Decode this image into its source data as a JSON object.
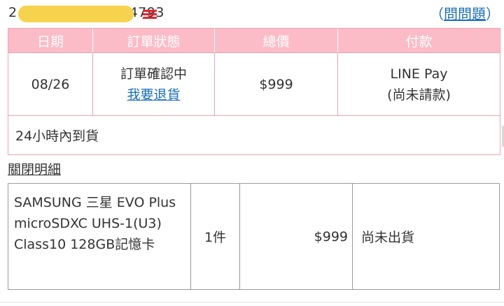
{
  "order": {
    "number_prefix": "2",
    "number_suffix": "4793",
    "brand_icon": "brand-stripes-icon",
    "ask_link": {
      "open_paren": "（",
      "label": "問問題",
      "close_paren": "）"
    }
  },
  "order_table": {
    "headers": [
      "日期",
      "訂單狀態",
      "總價",
      "付款"
    ],
    "date": "08/26",
    "status": "訂單確認中",
    "return_link": "我要退貨",
    "total": "$999",
    "payment_method": "LINE Pay",
    "payment_status": "(尚未請款)",
    "delivery_note": "24小時內到貨"
  },
  "detail_toggle": "關閉明細",
  "items": [
    {
      "name": "SAMSUNG 三星 EVO Plus microSDXC UHS-1(U3) Class10 128GB記憶卡",
      "quantity": "1件",
      "price": "$999",
      "shipping_status": "尚未出貨"
    }
  ],
  "colors": {
    "header_pink": "#fbbcc8",
    "border_pink": "#f2a3b1",
    "link_blue": "#1a6fb8",
    "brand_red": "#e3262e",
    "redaction_yellow": "#f6d34c"
  }
}
